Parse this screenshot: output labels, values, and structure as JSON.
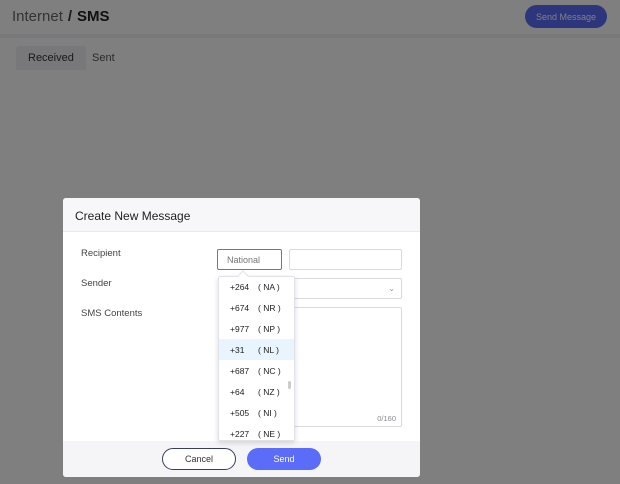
{
  "header": {
    "breadcrumb_parent": "Internet",
    "breadcrumb_separator": "/",
    "breadcrumb_current": "SMS",
    "send_message_label": "Send Message"
  },
  "tabs": [
    {
      "label": "Received"
    },
    {
      "label": "Sent"
    }
  ],
  "modal": {
    "title": "Create New Message",
    "recipient_label": "Recipient",
    "sender_label": "Sender",
    "contents_label": "SMS Contents",
    "national_placeholder": "National",
    "number_value": "",
    "char_count": "0/160",
    "cancel_label": "Cancel",
    "send_label": "Send"
  },
  "dropdown": {
    "items": [
      {
        "code": "+264",
        "country": "( NA )"
      },
      {
        "code": "+674",
        "country": "( NR )"
      },
      {
        "code": "+977",
        "country": "( NP )"
      },
      {
        "code": "+31",
        "country": "( NL )"
      },
      {
        "code": "+687",
        "country": "( NC )"
      },
      {
        "code": "+64",
        "country": "( NZ )"
      },
      {
        "code": "+505",
        "country": "( NI )"
      },
      {
        "code": "+227",
        "country": "( NE )"
      }
    ],
    "selected_index": 3
  },
  "colors": {
    "accent": "#5b6cf9",
    "selected_row": "#e8f4ff"
  }
}
